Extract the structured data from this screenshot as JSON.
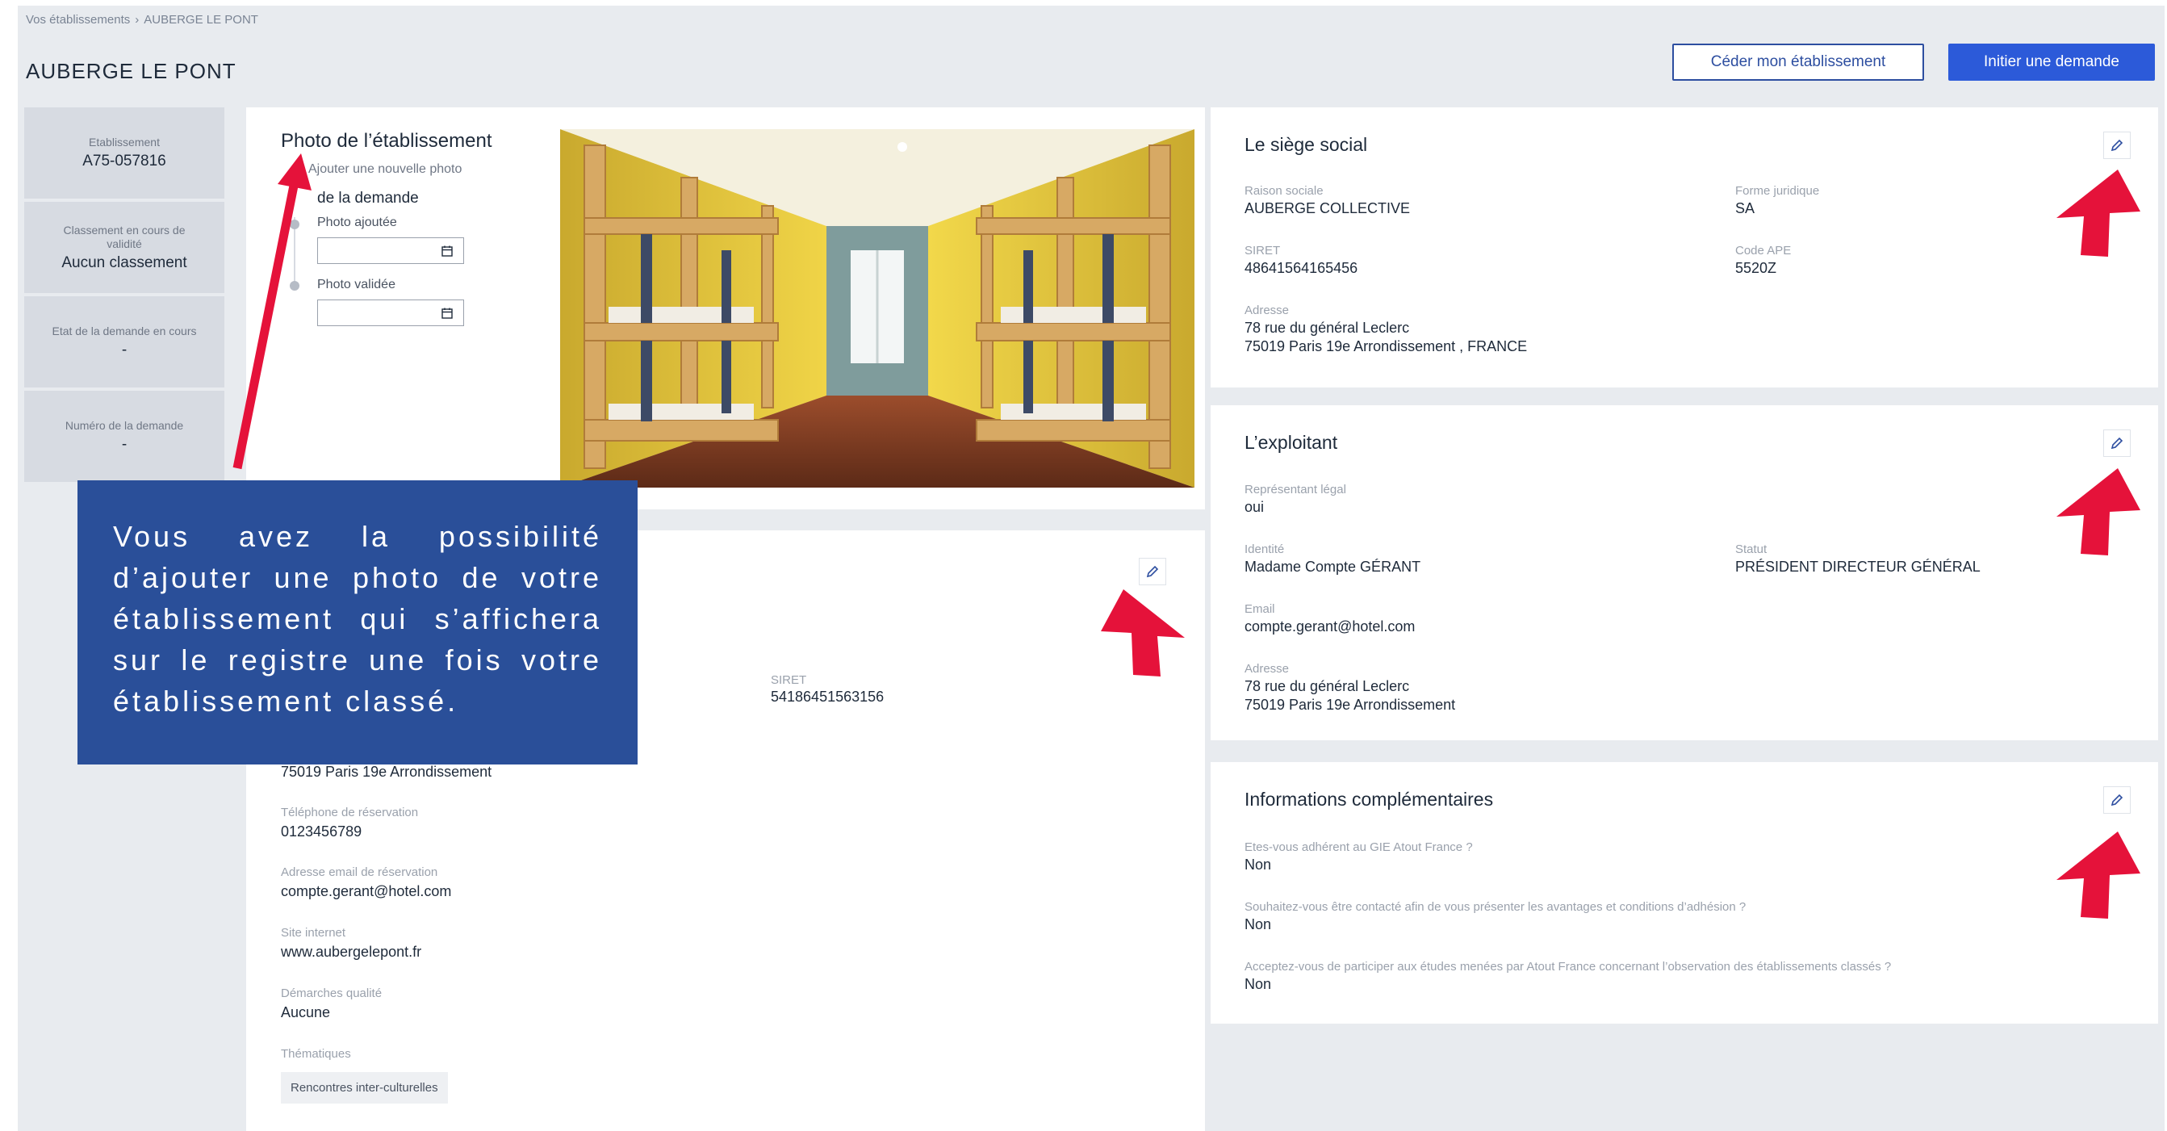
{
  "breadcrumb": {
    "parent": "Vos établissements",
    "sep": "›",
    "current": "AUBERGE LE PONT"
  },
  "page_title": "AUBERGE LE PONT",
  "actions": {
    "cede": "Céder mon établissement",
    "initiate": "Initier une demande"
  },
  "sidebar": [
    {
      "label": "Etablissement",
      "value": "A75-057816"
    },
    {
      "label": "Classement en cours de validité",
      "value": "Aucun classement"
    },
    {
      "label": "Etat de la demande en cours",
      "value": "-"
    },
    {
      "label": "Numéro de la demande",
      "value": "-"
    }
  ],
  "photo_card": {
    "title": "Photo de l’établissement",
    "add_link": "Ajouter une nouvelle photo",
    "status_title": "de la demande",
    "step1": "Photo ajoutée",
    "step2": "Photo validée"
  },
  "establishment_card": {
    "siret_label": "SIRET",
    "siret_value": "54186451563156",
    "address_line2": "75019 Paris 19e Arrondissement",
    "phone_label": "Téléphone de réservation",
    "phone_value": "0123456789",
    "email_label": "Adresse email de réservation",
    "email_value": "compte.gerant@hotel.com",
    "site_label": "Site internet",
    "site_value": "www.aubergelepont.fr",
    "quality_label": "Démarches qualité",
    "quality_value": "Aucune",
    "themes_label": "Thématiques",
    "theme_tag": "Rencontres inter-culturelles"
  },
  "siege": {
    "title": "Le siège social",
    "raison_label": "Raison sociale",
    "raison_value": "AUBERGE COLLECTIVE",
    "forme_label": "Forme juridique",
    "forme_value": "SA",
    "siret_label": "SIRET",
    "siret_value": "48641564165456",
    "ape_label": "Code APE",
    "ape_value": "5520Z",
    "address_label": "Adresse",
    "address_line1": "78 rue du général Leclerc",
    "address_line2": "75019 Paris 19e Arrondissement , FRANCE"
  },
  "exploitant": {
    "title": "L’exploitant",
    "rep_label": "Représentant légal",
    "rep_value": "oui",
    "identity_label": "Identité",
    "identity_value": "Madame Compte GÉRANT",
    "status_label": "Statut",
    "status_value": "PRÉSIDENT DIRECTEUR GÉNÉRAL",
    "email_label": "Email",
    "email_value": "compte.gerant@hotel.com",
    "address_label": "Adresse",
    "address_line1": "78 rue du général Leclerc",
    "address_line2": "75019 Paris 19e Arrondissement"
  },
  "infos": {
    "title": "Informations complémentaires",
    "q1": "Etes-vous adhérent au GIE Atout France ?",
    "a1": "Non",
    "q2": "Souhaitez-vous être contacté afin de vous présenter les avantages et conditions d’adhésion ?",
    "a2": "Non",
    "q3": "Acceptez-vous de participer aux études menées par Atout France concernant l’observation des établissements classés ?",
    "a3": "Non"
  },
  "tooltip": "Vous avez la possibilité d’ajouter une photo de votre établissement qui s’affichera sur le registre une fois votre établissement classé.",
  "colors": {
    "primary": "#2c5ad9",
    "overlay": "#2a4f99",
    "arrow": "#e5123a"
  },
  "icons": {
    "edit": "pencil-icon",
    "attach": "paperclip-icon",
    "calendar": "calendar-icon"
  }
}
